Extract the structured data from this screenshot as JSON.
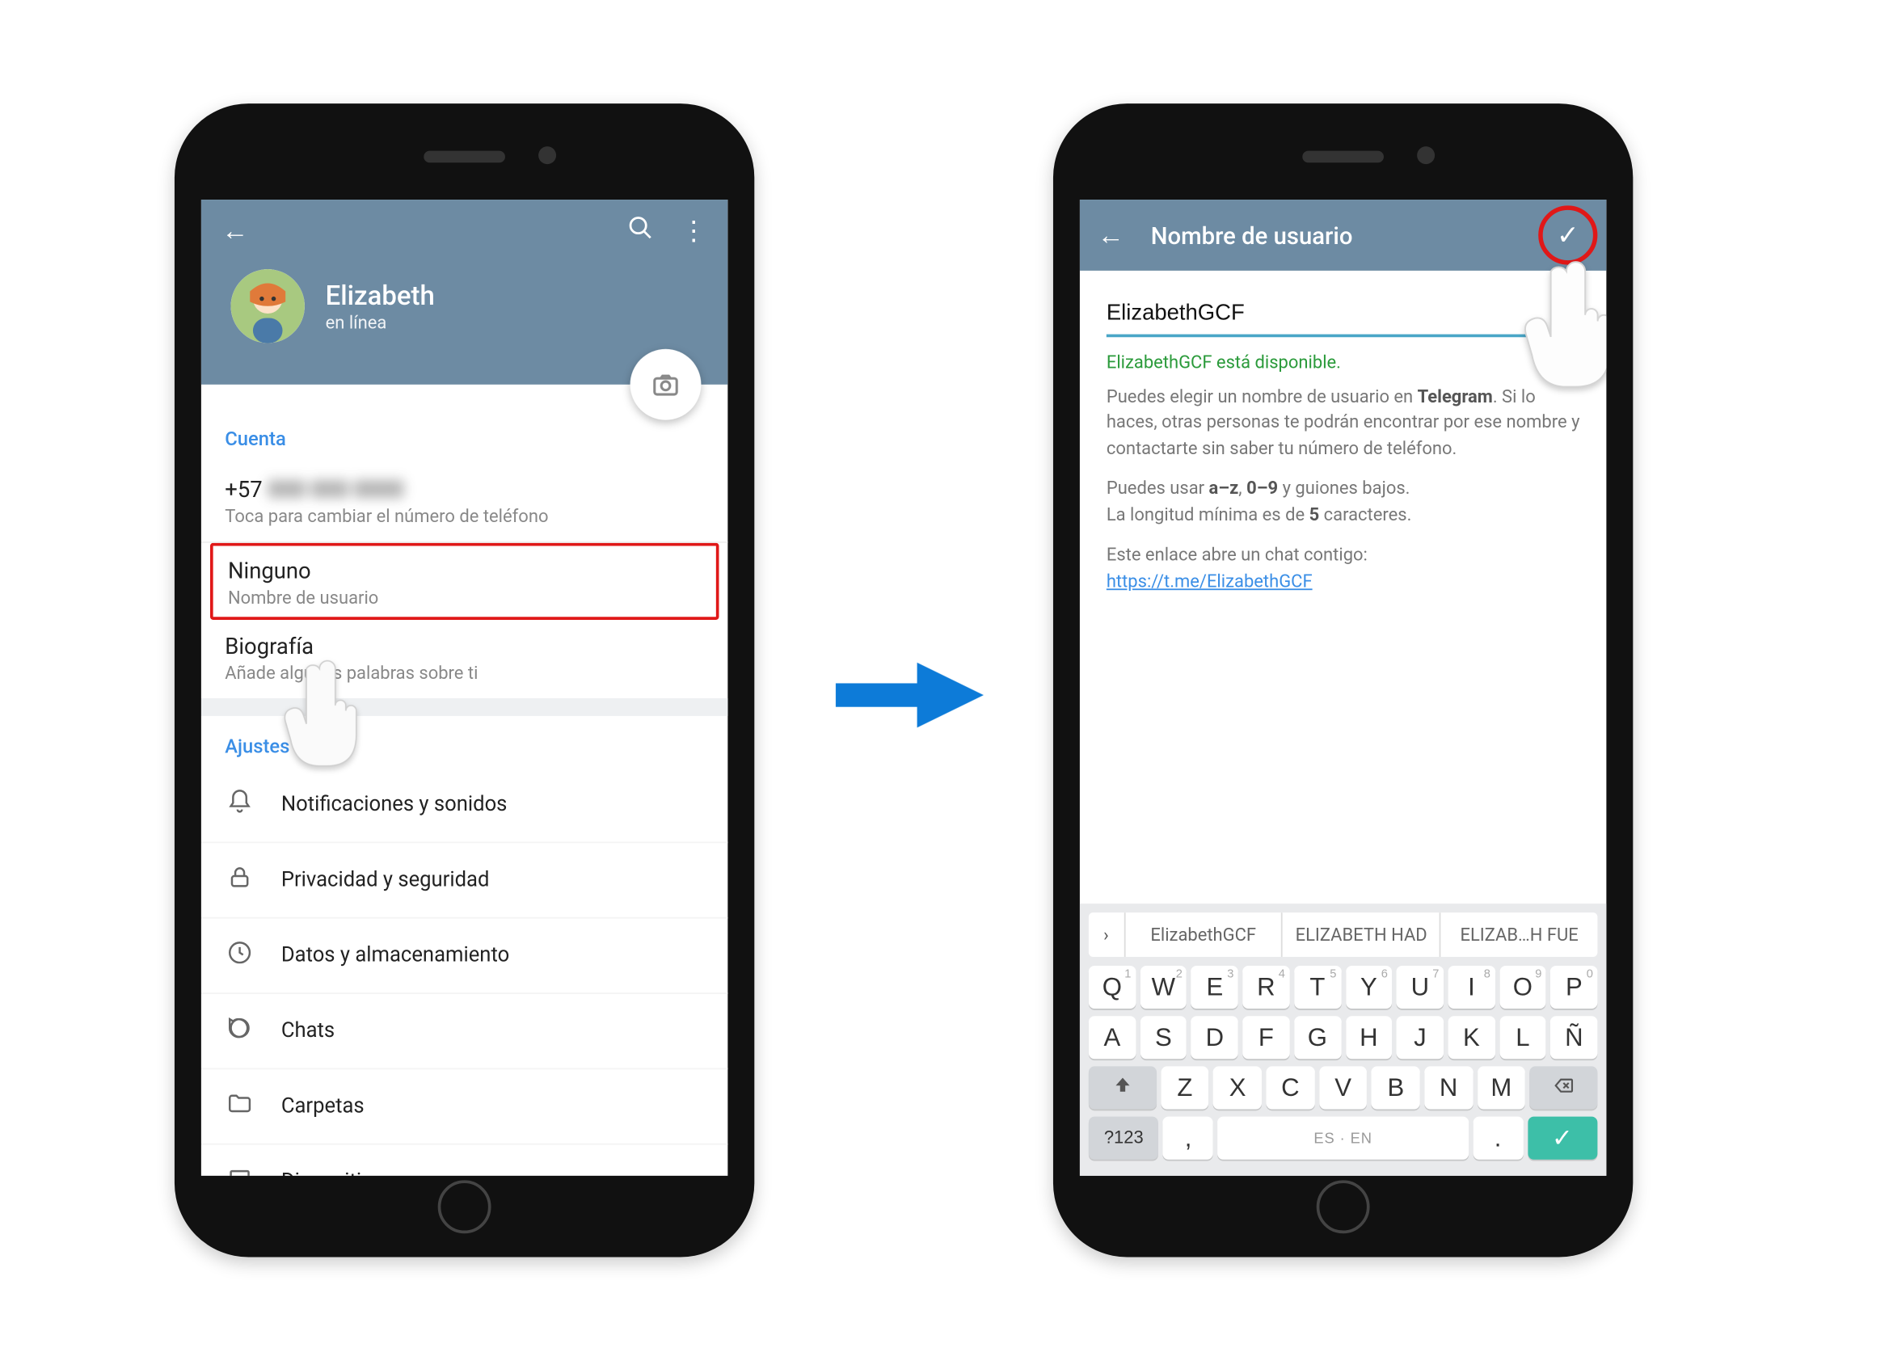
{
  "phone1": {
    "header": {
      "name": "Elizabeth",
      "status": "en línea"
    },
    "section_account": "Cuenta",
    "phone_prefix": "+57 ",
    "phone_rest": "000 000 0000",
    "phone_sub": "Toca para cambiar el número de teléfono",
    "username_value": "Ninguno",
    "username_sub": "Nombre de usuario",
    "bio_value": "Biografía",
    "bio_sub": "Añade algunas palabras sobre ti",
    "section_settings": "Ajustes",
    "settings": [
      {
        "icon": "bell-icon",
        "glyph": "🔔",
        "label": "Notificaciones y sonidos"
      },
      {
        "icon": "lock-icon",
        "glyph": "🔒",
        "label": "Privacidad y seguridad"
      },
      {
        "icon": "clock-icon",
        "glyph": "🕘",
        "label": "Datos y almacenamiento"
      },
      {
        "icon": "chat-icon",
        "glyph": "💬",
        "label": "Chats"
      },
      {
        "icon": "folder-icon",
        "glyph": "📁",
        "label": "Carpetas"
      },
      {
        "icon": "laptop-icon",
        "glyph": "💻",
        "label": "Dispositivos"
      }
    ]
  },
  "phone2": {
    "title": "Nombre de usuario",
    "input_value": "ElizabethGCF",
    "availability": "ElizabethGCF está disponible.",
    "para1_a": "Puedes elegir un nombre de usuario en ",
    "para1_bold": "Telegram",
    "para1_b": ". Si lo haces, otras personas te podrán encontrar por ese nombre y contactarte sin saber tu número de teléfono.",
    "para2_a": "Puedes usar ",
    "para2_b1": "a–z",
    "para2_mid": ", ",
    "para2_b2": "0–9",
    "para2_c": " y guiones bajos.",
    "para2_d": "La longitud mínima es de ",
    "para2_b3": "5",
    "para2_e": " caracteres.",
    "link_intro": "Este enlace abre un chat contigo:",
    "link": "https://t.me/ElizabethGCF",
    "suggestions": [
      "ElizabethGCF",
      "ELIZABETH HAD",
      "ELIZAB…H FUE"
    ],
    "rows": {
      "r1": [
        {
          "main": "Q",
          "sup": "1"
        },
        {
          "main": "W",
          "sup": "2"
        },
        {
          "main": "E",
          "sup": "3"
        },
        {
          "main": "R",
          "sup": "4"
        },
        {
          "main": "T",
          "sup": "5"
        },
        {
          "main": "Y",
          "sup": "6"
        },
        {
          "main": "U",
          "sup": "7"
        },
        {
          "main": "I",
          "sup": "8"
        },
        {
          "main": "O",
          "sup": "9"
        },
        {
          "main": "P",
          "sup": "0"
        }
      ],
      "r2": [
        {
          "main": "A"
        },
        {
          "main": "S"
        },
        {
          "main": "D"
        },
        {
          "main": "F"
        },
        {
          "main": "G"
        },
        {
          "main": "H"
        },
        {
          "main": "J"
        },
        {
          "main": "K"
        },
        {
          "main": "L"
        },
        {
          "main": "Ñ"
        }
      ],
      "r3": [
        {
          "main": "Z"
        },
        {
          "main": "X"
        },
        {
          "main": "C"
        },
        {
          "main": "V"
        },
        {
          "main": "B"
        },
        {
          "main": "N"
        },
        {
          "main": "M"
        }
      ]
    },
    "numkey": "?123",
    "spacelabel": "ES · EN",
    "comma": ",",
    "period": "."
  }
}
